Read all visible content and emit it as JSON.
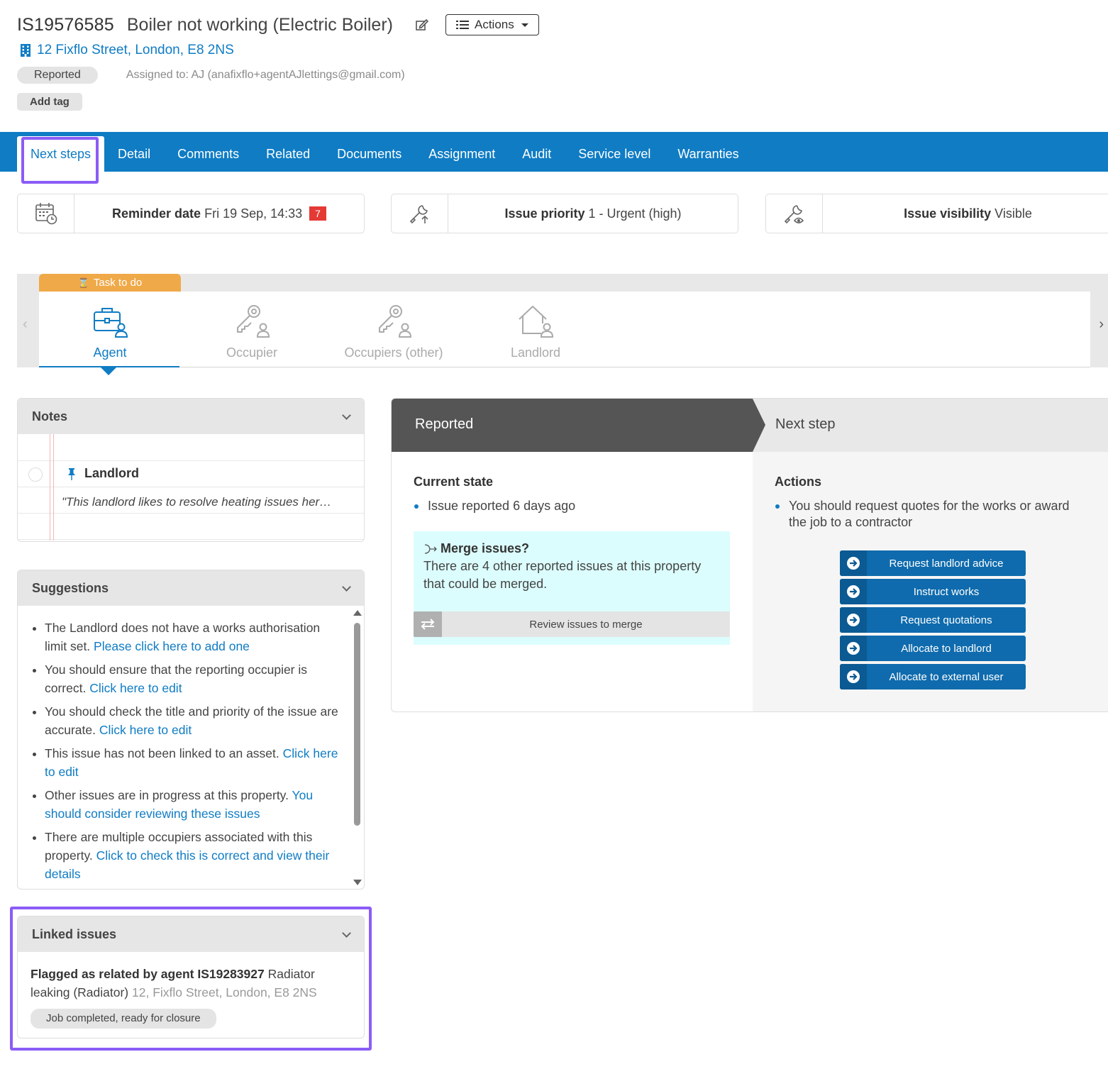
{
  "header": {
    "issue_id": "IS19576585",
    "issue_title": "Boiler not working (Electric Boiler)",
    "actions_label": "Actions",
    "address": "12 Fixflo Street, London, E8 2NS",
    "status": "Reported",
    "assigned_to": "Assigned to: AJ (anafixflo+agentAJlettings@gmail.com)",
    "add_tag_label": "Add tag"
  },
  "tabs": [
    {
      "label": "Next steps"
    },
    {
      "label": "Detail"
    },
    {
      "label": "Comments"
    },
    {
      "label": "Related"
    },
    {
      "label": "Documents"
    },
    {
      "label": "Assignment"
    },
    {
      "label": "Audit"
    },
    {
      "label": "Service level"
    },
    {
      "label": "Warranties"
    }
  ],
  "info_cards": {
    "reminder": {
      "label": "Reminder date",
      "value": "Fri 19 Sep, 14:33",
      "badge": "7"
    },
    "priority": {
      "label": "Issue priority",
      "value": "1 - Urgent (high)"
    },
    "visibility": {
      "label": "Issue visibility",
      "value": "Visible"
    }
  },
  "parties": {
    "task_label": "Task to do",
    "items": [
      {
        "label": "Agent"
      },
      {
        "label": "Occupier"
      },
      {
        "label": "Occupiers (other)"
      },
      {
        "label": "Landlord"
      }
    ]
  },
  "notes": {
    "title": "Notes",
    "note_title": "Landlord",
    "note_text": "\"This landlord likes to resolve heating issues her…"
  },
  "suggestions": {
    "title": "Suggestions",
    "items": [
      {
        "text": "The Landlord does not have a works authorisation limit set. ",
        "link": "Please click here to add one"
      },
      {
        "text": "You should ensure that the reporting occupier is correct. ",
        "link": "Click here to edit"
      },
      {
        "text": "You should check the title and priority of the issue are accurate. ",
        "link": "Click here to edit"
      },
      {
        "text": "This issue has not been linked to an asset. ",
        "link": "Click here to edit"
      },
      {
        "text": "Other issues are in progress at this property. ",
        "link": "You should consider reviewing these issues"
      },
      {
        "text": "There are multiple occupiers associated with this property. ",
        "link": "Click to check this is correct and view their details"
      }
    ]
  },
  "linked_issues": {
    "title": "Linked issues",
    "flag_label": "Flagged as related by agent IS19283927",
    "issue_title": "Radiator leaking (Radiator)",
    "address": "12, Fixflo Street, London, E8 2NS",
    "status": "Job completed, ready for closure"
  },
  "workflow": {
    "current_header": "Reported",
    "next_header": "Next step",
    "current_state_title": "Current state",
    "current_state_item": "Issue reported 6 days ago",
    "merge_title": "Merge issues?",
    "merge_text": "There are 4 other reported issues at this property that could be merged.",
    "merge_button": "Review issues to merge",
    "actions_title": "Actions",
    "actions_item": "You should request quotes for the works or award the job to a contractor",
    "buttons": [
      {
        "label": "Request landlord advice"
      },
      {
        "label": "Instruct works"
      },
      {
        "label": "Request quotations"
      },
      {
        "label": "Allocate to landlord"
      },
      {
        "label": "Allocate to external user"
      }
    ]
  },
  "colors": {
    "brand_blue": "#0f7cc4",
    "highlight": "#8b5cf6",
    "task_orange": "#f0a948",
    "badge_red": "#e53935",
    "merge_bg": "#dcfdfd"
  }
}
